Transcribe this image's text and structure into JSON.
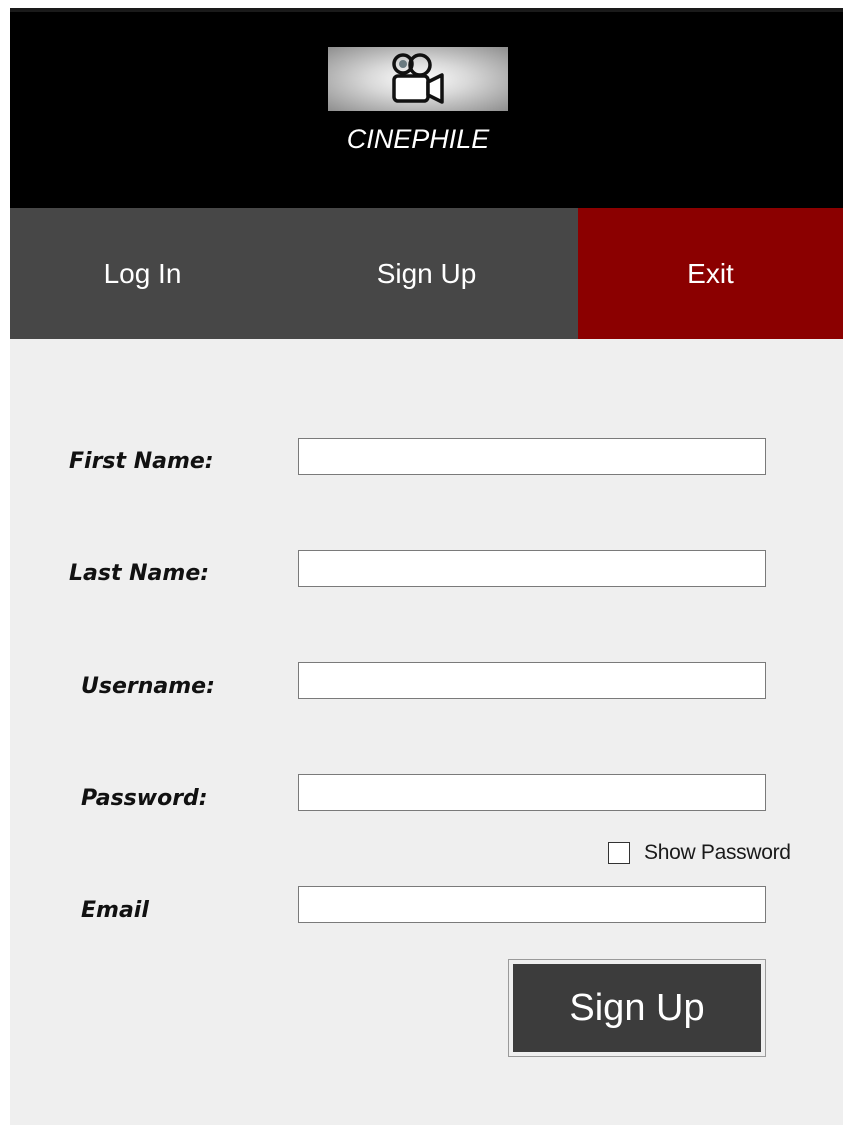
{
  "header": {
    "brand": "CINEPHILE",
    "logo_icon": "video-camera-icon"
  },
  "nav": {
    "login": "Log In",
    "signup": "Sign Up",
    "exit": "Exit"
  },
  "colors": {
    "header_bg": "#000000",
    "nav_bg": "#474747",
    "exit_bg": "#8b0000",
    "form_bg": "#efefef",
    "button_bg": "#3c3c3c"
  },
  "form": {
    "first_name": {
      "label": "First Name:",
      "value": ""
    },
    "last_name": {
      "label": "Last Name:",
      "value": ""
    },
    "username": {
      "label": "Username:",
      "value": ""
    },
    "password": {
      "label": "Password:",
      "value": ""
    },
    "show_password": {
      "label": "Show Password",
      "checked": false
    },
    "email": {
      "label": "Email",
      "value": ""
    },
    "submit_label": "Sign Up"
  }
}
